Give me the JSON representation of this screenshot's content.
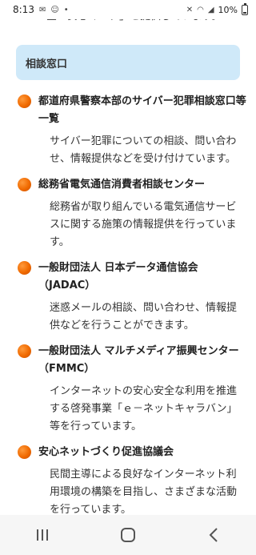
{
  "status": {
    "time": "8:13",
    "battery": "10%"
  },
  "top_text": "全・安心マーク」を提供しています。",
  "section": {
    "title": "相談窓口"
  },
  "items": [
    {
      "title": "都道府県警察本部のサイバー犯罪相談窓口等一覧",
      "desc": "サイバー犯罪についての相談、問い合わせ、情報提供などを受け付けています。"
    },
    {
      "title": "総務省電気通信消費者相談センター",
      "desc": "総務省が取り組んでいる電気通信サービスに関する施策の情報提供を行っています。"
    },
    {
      "title": "一般財団法人 日本データ通信協会（JADAC）",
      "desc": "迷惑メールの相談、問い合わせ、情報提供などを行うことができます。"
    },
    {
      "title": "一般財団法人 マルチメディア振興センター（FMMC）",
      "desc": "インターネットの安心安全な利用を推進する啓発事業「ｅ－ネットキャラバン」等を行っています。"
    },
    {
      "title": "安心ネットづくり促進協議会",
      "desc": "民間主導による良好なインターネット利用環境の構築を目指し、さまざまな活動を行っています。"
    }
  ],
  "nav": {
    "recents_icon": "recents-icon",
    "home_icon": "home-icon",
    "back_icon": "back-icon"
  }
}
